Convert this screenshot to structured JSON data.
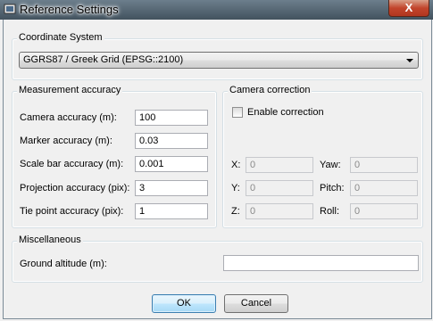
{
  "window": {
    "title": "Reference Settings",
    "close_label": "X"
  },
  "coordinate_system": {
    "group_label": "Coordinate System",
    "selected": "GGRS87 / Greek Grid (EPSG::2100)"
  },
  "measurement_accuracy": {
    "group_label": "Measurement accuracy",
    "fields": [
      {
        "label": "Camera accuracy (m):",
        "value": "100"
      },
      {
        "label": "Marker accuracy (m):",
        "value": "0.03"
      },
      {
        "label": "Scale bar accuracy (m):",
        "value": "0.001"
      },
      {
        "label": "Projection accuracy (pix):",
        "value": "3"
      },
      {
        "label": "Tie point accuracy (pix):",
        "value": "1"
      }
    ]
  },
  "camera_correction": {
    "group_label": "Camera correction",
    "enable_label": "Enable correction",
    "enabled": false,
    "x_label": "X:",
    "x_value": "0",
    "y_label": "Y:",
    "y_value": "0",
    "z_label": "Z:",
    "z_value": "0",
    "yaw_label": "Yaw:",
    "yaw_value": "0",
    "pitch_label": "Pitch:",
    "pitch_value": "0",
    "roll_label": "Roll:",
    "roll_value": "0"
  },
  "miscellaneous": {
    "group_label": "Miscellaneous",
    "ground_altitude_label": "Ground altitude (m):",
    "ground_altitude_value": ""
  },
  "buttons": {
    "ok": "OK",
    "cancel": "Cancel"
  }
}
